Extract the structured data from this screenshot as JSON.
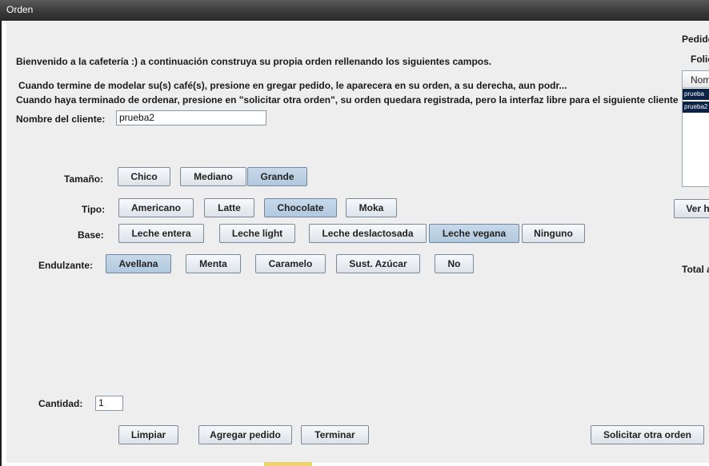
{
  "window": {
    "title": "Orden"
  },
  "intro": {
    "welcome": "Bienvenido a la cafetería :) a continuación construya su propia orden rellenando los siguientes campos.",
    "line1": "Cuando termine de modelar su(s) café(s), presione en gregar pedido, le aparecera en su orden, a su derecha, aun podr...",
    "line2": "Cuando haya terminado de ordenar, presione en \"solicitar otra orden\", su orden quedara registrada, pero la interfaz libre para el siguiente cliente"
  },
  "cliente": {
    "label": "Nombre del cliente:",
    "value": "prueba2"
  },
  "tamano": {
    "label": "Tamaño:",
    "options": [
      "Chico",
      "Mediano",
      "Grande"
    ],
    "selected": "Grande"
  },
  "tipo": {
    "label": "Tipo:",
    "options": [
      "Americano",
      "Latte",
      "Chocolate",
      "Moka"
    ],
    "selected": "Chocolate"
  },
  "base": {
    "label": "Base:",
    "options": [
      "Leche entera",
      "Leche light",
      "Leche deslactosada",
      "Leche vegana",
      "Ninguno"
    ],
    "selected": "Leche vegana"
  },
  "endulzante": {
    "label": "Endulzante:",
    "options": [
      "Avellana",
      "Menta",
      "Caramelo",
      "Sust. Azúcar",
      "No"
    ],
    "selected": "Avellana"
  },
  "cantidad": {
    "label": "Cantidad:",
    "value": "1"
  },
  "actions": {
    "limpiar": "Limpiar",
    "agregar": "Agregar pedido",
    "terminar": "Terminar",
    "solicitar": "Solicitar otra orden"
  },
  "right_panel": {
    "pedidos_label": "Pedido",
    "folio_label": "Folic",
    "list_header": "Nom",
    "list_rows": [
      "prueba",
      "prueba2"
    ],
    "ver_button": "Ver h",
    "total_label": "Total a"
  }
}
